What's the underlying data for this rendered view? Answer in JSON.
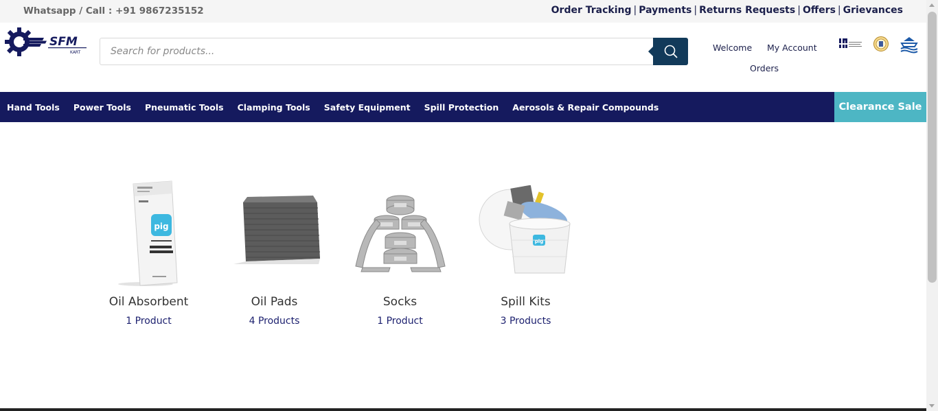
{
  "topbar": {
    "contact": "Whatsapp / Call : +91 9867235152",
    "links": [
      "Order Tracking",
      "Payments",
      "Returns Requests",
      "Offers",
      "Grievances"
    ]
  },
  "logo": {
    "text": "SFM",
    "sub": "KART"
  },
  "search": {
    "placeholder": "Search for products...",
    "value": ""
  },
  "account": {
    "welcome": "Welcome",
    "my_account": "My Account",
    "orders": "Orders"
  },
  "header_icons": [
    "impa-logo-icon",
    "certification-seal-icon",
    "ship-anchor-icon"
  ],
  "nav": {
    "items": [
      "Hand Tools",
      "Power Tools",
      "Pneumatic Tools",
      "Clamping Tools",
      "Safety Equipment",
      "Spill Protection",
      "Aerosols & Repair Compounds"
    ],
    "clearance": "Clearance Sale"
  },
  "categories": [
    {
      "name": "Oil Absorbent",
      "count": "1 Product"
    },
    {
      "name": "Oil Pads",
      "count": "4 Products"
    },
    {
      "name": "Socks",
      "count": "1 Product"
    },
    {
      "name": "Spill Kits",
      "count": "3 Products"
    }
  ],
  "colors": {
    "nav_bg": "#151a5e",
    "clearance_bg": "#4db6c4",
    "search_button": "#123a5a",
    "link_text": "#1b1f6e"
  }
}
